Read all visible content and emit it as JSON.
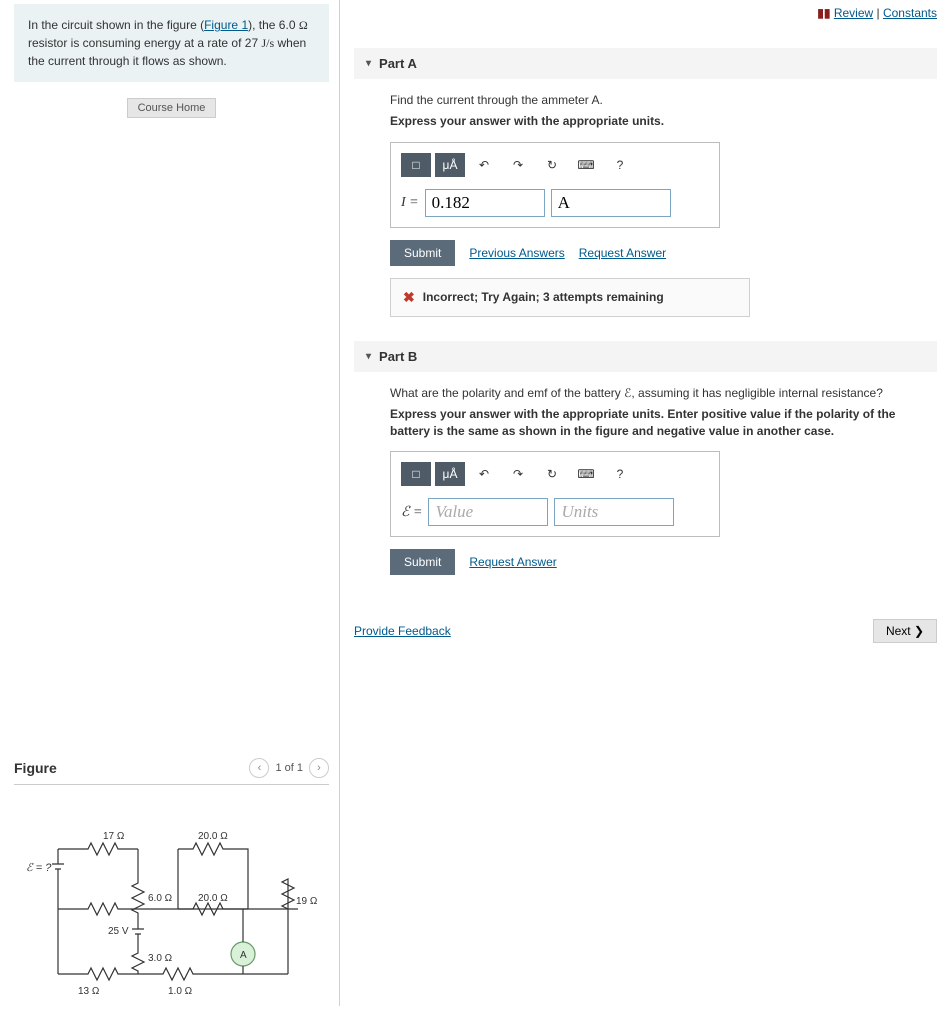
{
  "topLinks": {
    "review": "Review",
    "constants": "Constants",
    "sep": " | "
  },
  "context": {
    "pre": "In the circuit shown in the figure (",
    "figlink": "Figure 1",
    "post1": "), the 6.0 ",
    "ohm1": "Ω",
    "post2": " resistor is consuming energy at a rate of 27 ",
    "js": "J/s",
    "post3": " when the current through it flows as shown."
  },
  "courseHome": "Course Home",
  "figure": {
    "title": "Figure",
    "pager": "1 of 1",
    "labels": {
      "r20a": "20.0 Ω",
      "r17": "17 Ω",
      "r6": "6.0 Ω",
      "r20b": "20.0 Ω",
      "r19": "19 Ω",
      "r3": "3.0 Ω",
      "r13": "13 Ω",
      "r1": "1.0 Ω",
      "v25": "25 V",
      "eq": "ℰ = ?",
      "A": "A"
    }
  },
  "partA": {
    "title": "Part A",
    "question": "Find the current through the ammeter A.",
    "instruction": "Express your answer with the appropriate units.",
    "symbol": "I = ",
    "value": "0.182",
    "unit": "A",
    "submit": "Submit",
    "prevAnswers": "Previous Answers",
    "requestAnswer": "Request Answer",
    "feedback": "Incorrect; Try Again; 3 attempts remaining"
  },
  "partB": {
    "title": "Part B",
    "question": "What are the polarity and emf of the battery ℰ, assuming it has negligible internal resistance?",
    "instruction": "Express your answer with the appropriate units. Enter positive value if the polarity of the battery is the same as shown in the figure and negative value in another case.",
    "symbol": "ℰ = ",
    "valuePh": "Value",
    "unitPh": "Units",
    "submit": "Submit",
    "requestAnswer": "Request Answer"
  },
  "footer": {
    "provide": "Provide Feedback",
    "next": "Next ❯"
  },
  "toolbar": {
    "frac": "□",
    "mu": "μÅ",
    "undo": "↶",
    "redo": "↷",
    "reset": "↻",
    "kbd": "⌨",
    "help": "?"
  }
}
